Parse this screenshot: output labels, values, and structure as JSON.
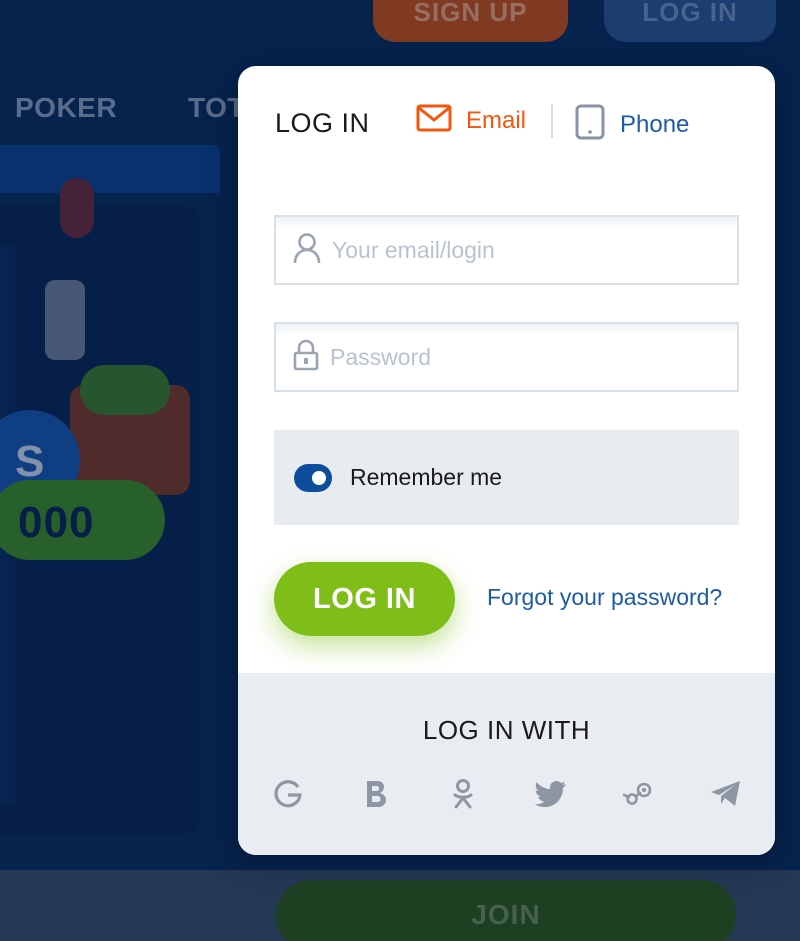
{
  "background": {
    "signup_label": "SIGN UP",
    "login_label": "LOG IN",
    "nav_items": [
      "POKER",
      "TOT"
    ],
    "banner_coin_text": "S",
    "banner_amount_text": "000",
    "join_label": "JOIN"
  },
  "modal": {
    "title": "LOG IN",
    "tabs": {
      "email": {
        "label": "Email",
        "icon": "envelope-icon",
        "active": true
      },
      "phone": {
        "label": "Phone",
        "icon": "phone-icon",
        "active": false
      }
    },
    "email_field": {
      "placeholder": "Your email/login",
      "value": "",
      "icon": "user-icon"
    },
    "password_field": {
      "placeholder": "Password",
      "value": "",
      "icon": "lock-icon"
    },
    "remember": {
      "label": "Remember me",
      "checked": true
    },
    "login_button": "LOG IN",
    "forgot_link": "Forgot your password?",
    "social": {
      "title": "LOG IN WITH",
      "providers": [
        "google",
        "b",
        "odnoklassniki",
        "twitter",
        "steam",
        "telegram"
      ]
    }
  },
  "colors": {
    "accent_orange": "#f2570c",
    "link_blue": "#1d5aa8",
    "login_green": "#7fbe19",
    "toggle_blue": "#0f4d9c"
  }
}
